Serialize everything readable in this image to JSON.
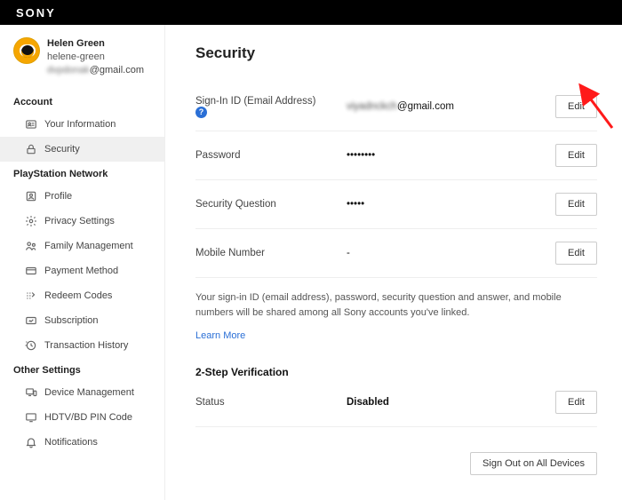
{
  "topbar": {
    "brand": "SONY"
  },
  "profile": {
    "name": "Helen Green",
    "handle": "helene-green",
    "email_obscured_prefix": "dvpdonak",
    "email_suffix": "@gmail.com"
  },
  "sidebar": {
    "groups": [
      {
        "title": "Account",
        "items": [
          {
            "label": "Your Information"
          },
          {
            "label": "Security"
          }
        ]
      },
      {
        "title": "PlayStation Network",
        "items": [
          {
            "label": "Profile"
          },
          {
            "label": "Privacy Settings"
          },
          {
            "label": "Family Management"
          },
          {
            "label": "Payment Method"
          },
          {
            "label": "Redeem Codes"
          },
          {
            "label": "Subscription"
          },
          {
            "label": "Transaction History"
          }
        ]
      },
      {
        "title": "Other Settings",
        "items": [
          {
            "label": "Device Management"
          },
          {
            "label": "HDTV/BD PIN Code"
          },
          {
            "label": "Notifications"
          }
        ]
      }
    ]
  },
  "page": {
    "title": "Security",
    "rows": [
      {
        "label": "Sign-In ID (Email Address)",
        "has_help": true,
        "value_obscured_prefix": "viyadnckch",
        "value_suffix": "@gmail.com",
        "edit": "Edit"
      },
      {
        "label": "Password",
        "value": "••••••••",
        "edit": "Edit"
      },
      {
        "label": "Security Question",
        "value": "•••••",
        "edit": "Edit"
      },
      {
        "label": "Mobile Number",
        "value": "-",
        "edit": "Edit"
      }
    ],
    "note": "Your sign-in ID (email address), password, security question and answer, and mobile numbers will be shared among all Sony accounts you've linked.",
    "learn_more": "Learn More",
    "two_step_heading": "2-Step Verification",
    "two_step_status_label": "Status",
    "two_step_status_value": "Disabled",
    "two_step_edit": "Edit",
    "sign_out_all": "Sign Out on All Devices"
  },
  "help_badge_text": "?"
}
